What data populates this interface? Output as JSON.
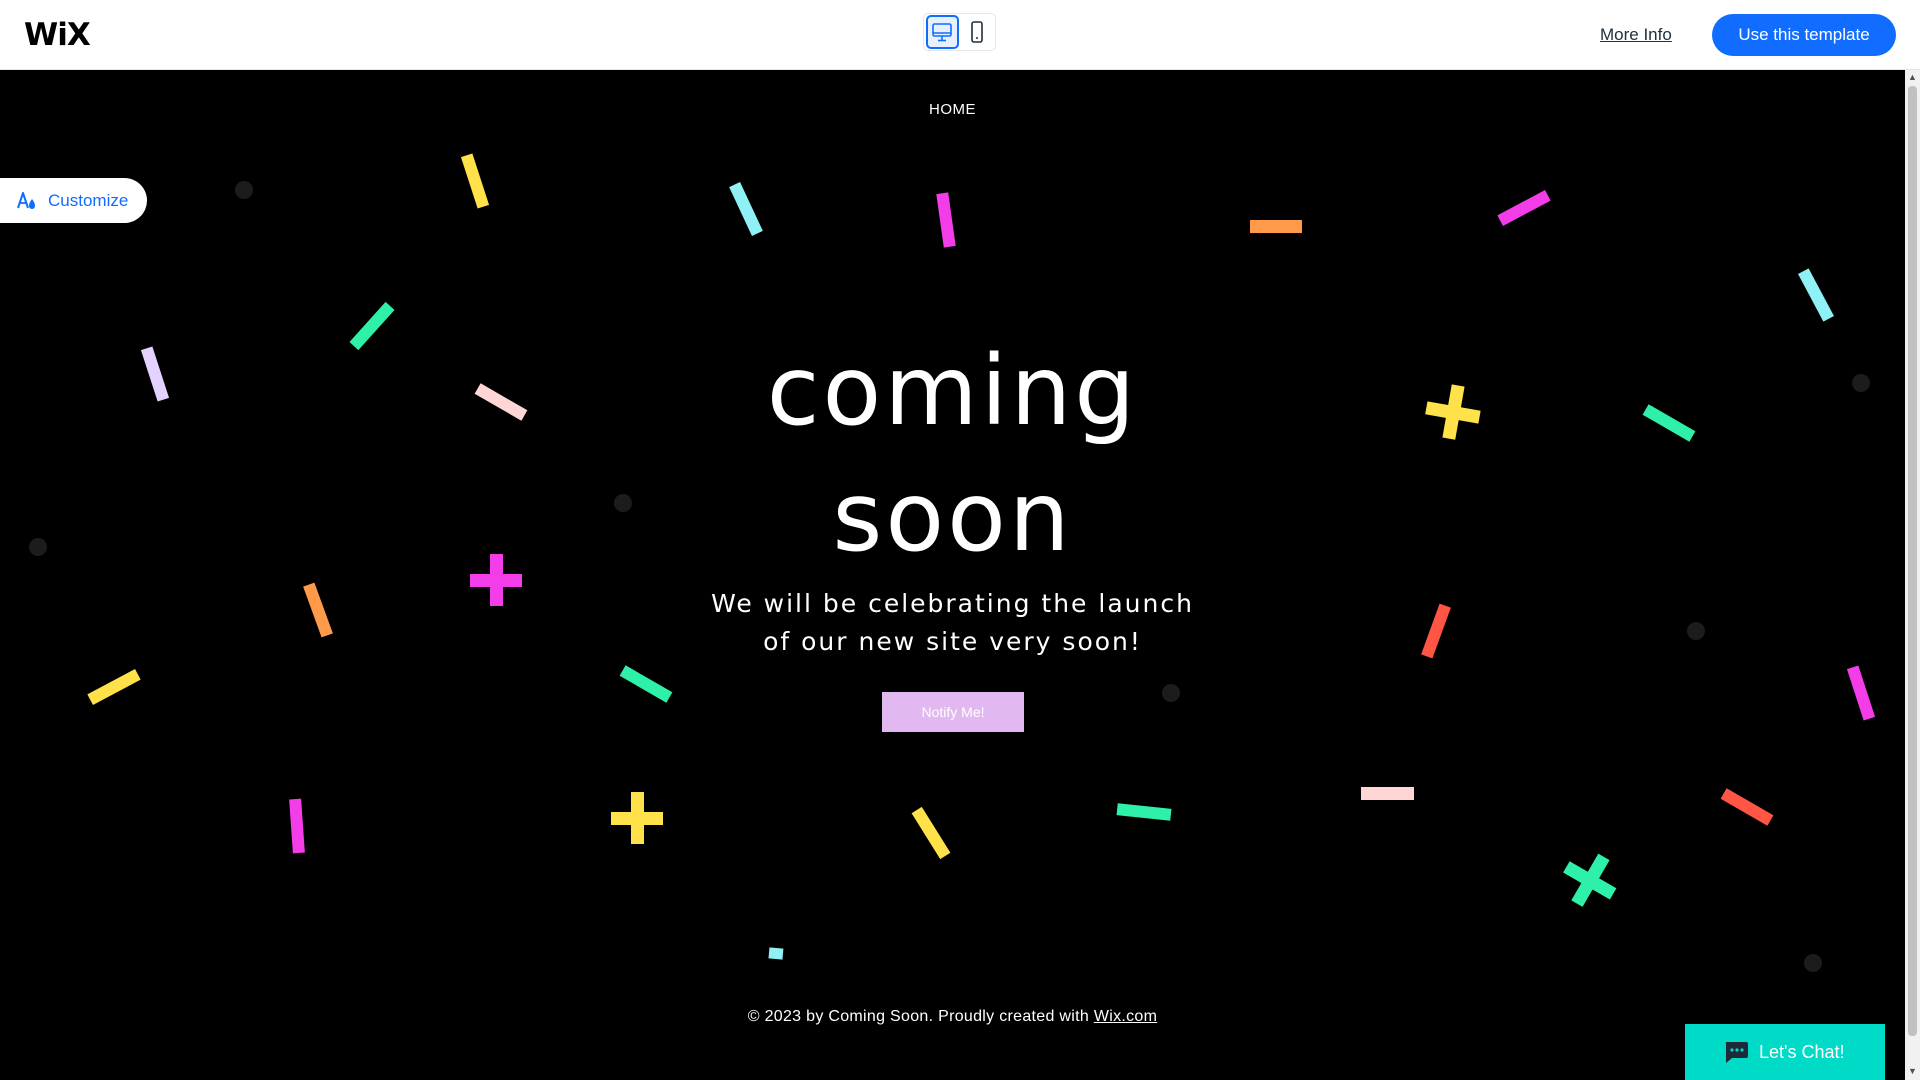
{
  "topbar": {
    "logo": "WiX",
    "more_info": "More Info",
    "use_template": "Use this template",
    "accent": "#116dff",
    "devices": [
      {
        "name": "desktop-icon",
        "active": true
      },
      {
        "name": "mobile-icon",
        "active": false
      }
    ]
  },
  "site": {
    "nav": {
      "home": "HOME"
    },
    "hero": {
      "title_line1": "coming",
      "title_line2": "soon",
      "subtitle_line1": "We will be celebrating the launch",
      "subtitle_line2": "of our new site very soon!"
    },
    "notify_button": "Notify Me!",
    "notify_color": "#e2b8f0",
    "footer": {
      "prefix": "© 2023 by Coming Soon. Proudly created with ",
      "link": "Wix.com"
    },
    "background": "#000000",
    "confetti_colors": [
      "#ffe24a",
      "#8ff0f5",
      "#f23de8",
      "#ff9a4a",
      "#2ef0a8",
      "#e3d2ff",
      "#ffd6d6",
      "#ff5545"
    ]
  },
  "customize": {
    "label": "Customize",
    "icon": "paint-drop-icon"
  },
  "chat": {
    "label": "Let's Chat!",
    "color": "#00dbc7",
    "icon": "chat-bubble-icon"
  }
}
